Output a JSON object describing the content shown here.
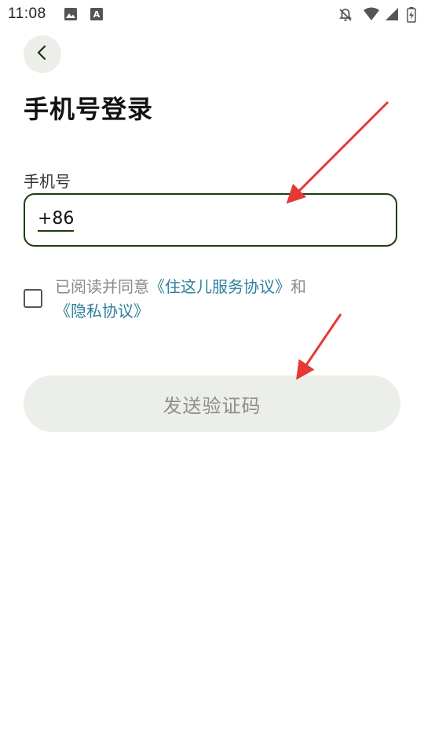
{
  "status_bar": {
    "time": "11:08",
    "left_icons": [
      "image-icon",
      "font-a-icon"
    ],
    "right_icons": [
      "notifications-off-icon",
      "wifi-icon",
      "signal-icon",
      "battery-icon"
    ]
  },
  "header": {
    "back_icon": "chevron-left-icon",
    "title": "手机号登录"
  },
  "phone": {
    "label": "手机号",
    "country_code": "+86",
    "value": "",
    "placeholder": ""
  },
  "agreement": {
    "checked": false,
    "prefix": "已阅读并同意",
    "service_link": "《住这儿服务协议》",
    "conjunction": "和",
    "privacy_link": "《隐私协议》"
  },
  "actions": {
    "send_code_label": "发送验证码"
  },
  "colors": {
    "accent_dark_green": "#1f3a0f",
    "link": "#2f7f9b",
    "button_bg": "#eceee9",
    "button_text": "#8e8e8e",
    "annotation_arrow": "#e53935"
  }
}
